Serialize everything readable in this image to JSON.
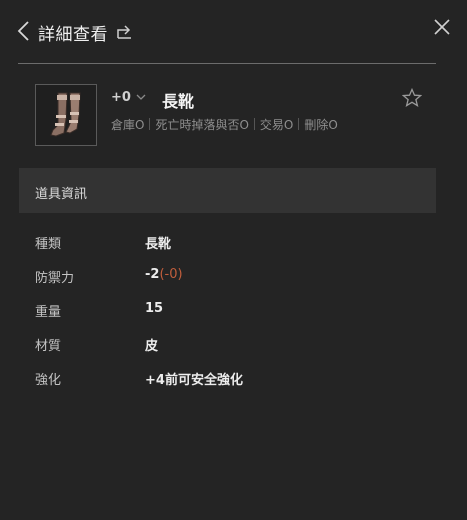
{
  "header": {
    "title": "詳細查看"
  },
  "item": {
    "enhance_level": "+0",
    "name": "長靴",
    "attributes": [
      "倉庫O",
      "死亡時掉落與否O",
      "交易O",
      "刪除O"
    ]
  },
  "section": {
    "title": "道具資訊"
  },
  "details": [
    {
      "label": "種類",
      "value": "長靴",
      "extra": ""
    },
    {
      "label": "防禦力",
      "value": "-2",
      "extra": "(-0)"
    },
    {
      "label": "重量",
      "value": "15",
      "extra": ""
    },
    {
      "label": "材質",
      "value": "皮",
      "extra": ""
    },
    {
      "label": "強化",
      "value": "+4前可安全強化",
      "extra": ""
    }
  ],
  "colors": {
    "background": "#242424",
    "section_bg": "#333333",
    "negative_modifier": "#c25e3c"
  },
  "icons": [
    "chevron-left-icon",
    "share-icon",
    "close-icon",
    "chevron-down-icon",
    "star-outline-icon",
    "boots-item-icon"
  ]
}
